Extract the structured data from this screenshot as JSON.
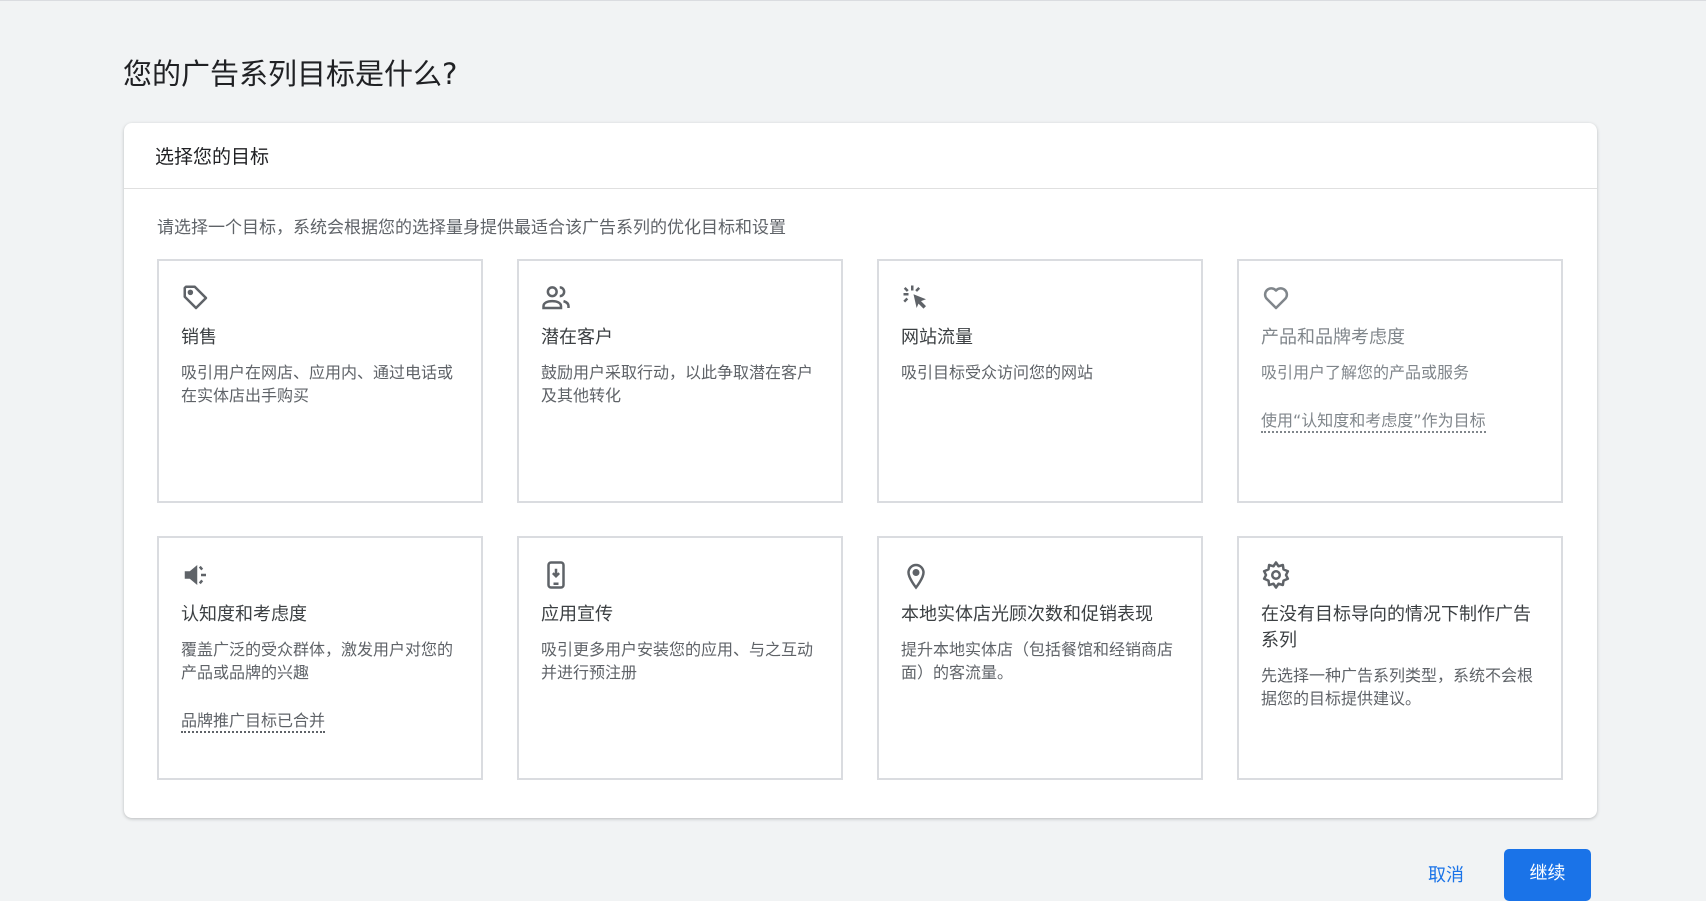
{
  "page_title": "您的广告系列目标是什么?",
  "panel": {
    "header": "选择您的目标",
    "subtitle": "请选择一个目标，系统会根据您的选择量身提供最适合该广告系列的优化目标和设置"
  },
  "goals": [
    {
      "icon": "tag-icon",
      "title": "销售",
      "desc": "吸引用户在网店、应用内、通过电话或在实体店出手购买"
    },
    {
      "icon": "people-icon",
      "title": "潜在客户",
      "desc": "鼓励用户采取行动，以此争取潜在客户及其他转化"
    },
    {
      "icon": "cursor-click-icon",
      "title": "网站流量",
      "desc": "吸引目标受众访问您的网站"
    },
    {
      "icon": "heart-icon",
      "title": "产品和品牌考虑度",
      "desc": "吸引用户了解您的产品或服务",
      "link": "使用“认知度和考虑度”作为目标",
      "disabled": true
    },
    {
      "icon": "speaker-icon",
      "title": "认知度和考虑度",
      "desc": "覆盖广泛的受众群体，激发用户对您的产品或品牌的兴趣",
      "link": "品牌推广目标已合并"
    },
    {
      "icon": "phone-download-icon",
      "title": "应用宣传",
      "desc": "吸引更多用户安装您的应用、与之互动并进行预注册"
    },
    {
      "icon": "location-pin-icon",
      "title": "本地实体店光顾次数和促销表现",
      "desc": "提升本地实体店（包括餐馆和经销商店面）的客流量。"
    },
    {
      "icon": "gear-icon",
      "title": "在没有目标导向的情况下制作广告系列",
      "desc": "先选择一种广告系列类型，系统不会根据您的目标提供建议。"
    }
  ],
  "footer": {
    "cancel": "取消",
    "continue": "继续"
  },
  "colors": {
    "accent": "#1a73e8",
    "background": "#f1f3f4"
  }
}
